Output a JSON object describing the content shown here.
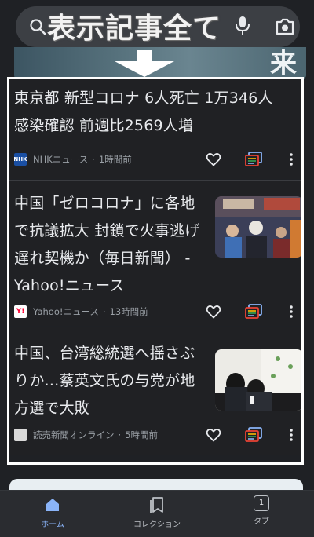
{
  "overlay": {
    "title": "表示記事全て"
  },
  "hero": {
    "glyph": "来"
  },
  "search": {
    "placeholder": ""
  },
  "articles": [
    {
      "headline_lines": [
        "東京都 新型コロナ 6人死亡 1万346人",
        "感染確認 前週比2569人増"
      ],
      "source": "NHKニュース",
      "time": "1時間前",
      "logo_text": "NHK",
      "logo_color": "#1a4fa3"
    },
    {
      "headline_lines": [
        "中国「ゼロコロナ」に各地",
        "で抗議拡大 封鎖で火事逃げ",
        "遅れ契機か（毎日新聞） -",
        "Yahoo!ニュース"
      ],
      "source": "Yahoo!ニュース",
      "time": "13時間前",
      "logo_text": "Y!",
      "logo_color": "#ff0033"
    },
    {
      "headline_lines": [
        "中国、台湾総統選へ揺さぶ",
        "りか…蔡英文氏の与党が地",
        "方選で大敗"
      ],
      "source": "読売新聞オンライン",
      "time": "5時間前",
      "logo_text": "",
      "logo_color": "#d9d9d9"
    }
  ],
  "separator": "·",
  "nav": {
    "home": "ホーム",
    "collections": "コレクション",
    "tabs": "タブ",
    "tab_count": "1"
  },
  "colors": {
    "accent": "#8ab4f8",
    "background": "#202124",
    "text": "#e8eaed",
    "muted": "#9aa0a6"
  }
}
